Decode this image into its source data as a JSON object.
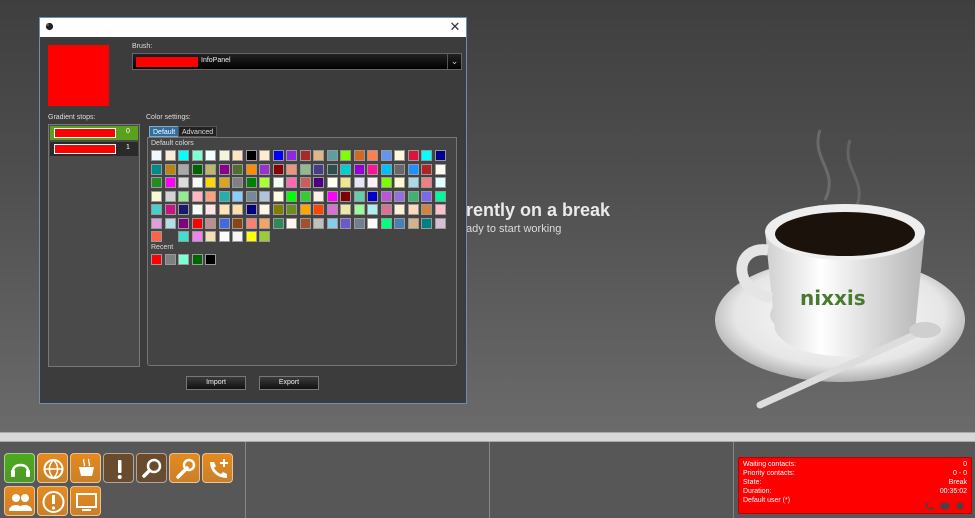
{
  "background": {
    "title": "rently on a break",
    "subtitle": "ady to start working"
  },
  "dialog": {
    "close_glyph": "✕",
    "preview_color": "#ff0000",
    "brush": {
      "label": "Brush:",
      "color": "#ff0000",
      "name": "InfoPanel"
    },
    "gradient_stops": {
      "label": "Gradient stops:",
      "items": [
        {
          "color": "#ff0000",
          "offset": "0"
        },
        {
          "color": "#ff0000",
          "offset": "1"
        }
      ]
    },
    "color_settings": {
      "label": "Color settings:",
      "tabs": [
        "Default",
        "Advanced"
      ],
      "default_colors_label": "Default colors",
      "recent_label": "Recent",
      "palette": [
        [
          "#f0f8ff",
          "#faebd7",
          "#00ffff",
          "#7fffd4",
          "#f0ffff",
          "#f5f5dc",
          "#ffe4c4",
          "#000000",
          "#ffebcd",
          "#0000ff",
          "#8a2be2",
          "#a52a2a",
          "#deb887",
          "#5f9ea0",
          "#7fff00",
          "#d2691e",
          "#ff7f50",
          "#6495ed",
          "#fff8dc",
          "#dc143c",
          "#00ffff",
          "#00008b"
        ],
        [
          "#008b8b",
          "#b8860b",
          "#a9a9a9",
          "#006400",
          "#bdb76b",
          "#8b008b",
          "#556b2f",
          "#ff8c00",
          "#9932cc",
          "#8b0000",
          "#e9967a",
          "#8fbc8f",
          "#483d8b",
          "#2f4f4f",
          "#00ced1",
          "#9400d3",
          "#ff1493",
          "#00bfff",
          "#696969",
          "#1e90ff",
          "#b22222",
          "#fffaf0"
        ],
        [
          "#228b22",
          "#ff00ff",
          "#dcdcdc",
          "#f8f8ff",
          "#ffd700",
          "#daa520",
          "#808080",
          "#008000",
          "#adff2f",
          "#f0fff0",
          "#ff69b4",
          "#cd5c5c",
          "#4b0082",
          "#fffff0",
          "#f0e68c",
          "#e6e6fa",
          "#fff0f5",
          "#7cfc00",
          "#fffacd",
          "#add8e6",
          "#f08080",
          "#e0ffff"
        ],
        [
          "#fafad2",
          "#d3d3d3",
          "#90ee90",
          "#ffb6c1",
          "#ffa07a",
          "#20b2aa",
          "#87cefa",
          "#778899",
          "#b0c4de",
          "#ffffe0",
          "#00ff00",
          "#32cd32",
          "#faf0e6",
          "#ff00ff",
          "#800000",
          "#66cdaa",
          "#0000cd",
          "#ba55d3",
          "#9370db",
          "#3cb371",
          "#7b68ee",
          "#00fa9a"
        ],
        [
          "#48d1cc",
          "#c71585",
          "#191970",
          "#f5fffa",
          "#ffe4e1",
          "#ffe4b5",
          "#ffdead",
          "#000080",
          "#fdf5e6",
          "#808000",
          "#6b8e23",
          "#ffa500",
          "#ff4500",
          "#da70d6",
          "#eee8aa",
          "#98fb98",
          "#afeeee",
          "#db7093",
          "#ffefd5",
          "#ffdab9",
          "#cd853f",
          "#ffc0cb"
        ],
        [
          "#dda0dd",
          "#b0e0e6",
          "#800080",
          "#ff0000",
          "#bc8f8f",
          "#4169e1",
          "#8b4513",
          "#fa8072",
          "#f4a460",
          "#2e8b57",
          "#fff5ee",
          "#a0522d",
          "#c0c0c0",
          "#87ceeb",
          "#6a5acd",
          "#708090",
          "#fffafa",
          "#00ff7f",
          "#4682b4",
          "#d2b48c",
          "#008080",
          "#d8bfd8"
        ],
        [
          "#ff6347",
          "#00000000",
          "#40e0d0",
          "#ee82ee",
          "#f5deb3",
          "#ffffff",
          "#f5f5f5",
          "#ffff00",
          "#9acd32"
        ]
      ],
      "recent": [
        "#ff0000",
        "#808080",
        "#7fffd4",
        "#006400",
        "#000000"
      ]
    },
    "buttons": {
      "import": "Import",
      "export": "Export"
    }
  },
  "status_panel": {
    "bg_color": "#ff0000",
    "rows": [
      {
        "key": "Waiting contacts:",
        "value": "0"
      },
      {
        "key": "Priority contacts:",
        "value": "0 - 0"
      },
      {
        "key": "State:",
        "value": "Break"
      },
      {
        "key": "Duration:",
        "value": "00:35:02"
      },
      {
        "key": "Default user (*)",
        "value": ""
      }
    ]
  },
  "toolbar": {
    "tiles": [
      {
        "icon": "headset-icon",
        "color": "#4caa1e"
      },
      {
        "icon": "globe-icon",
        "color": "#e68a1e"
      },
      {
        "icon": "coffee-cup-icon",
        "color": "#e68a1e"
      },
      {
        "icon": "exclamation-icon",
        "color": "#6b4a2a"
      },
      {
        "icon": "magnifier-icon",
        "color": "#6b4a2a"
      },
      {
        "icon": "wrench-icon",
        "color": "#e68a1e"
      },
      {
        "icon": "phone-add-icon",
        "color": "#e68a1e"
      },
      {
        "icon": "users-icon",
        "color": "#e68a1e"
      },
      {
        "icon": "alert-circle-icon",
        "color": "#e68a1e"
      },
      {
        "icon": "monitor-icon",
        "color": "#e68a1e"
      }
    ]
  }
}
